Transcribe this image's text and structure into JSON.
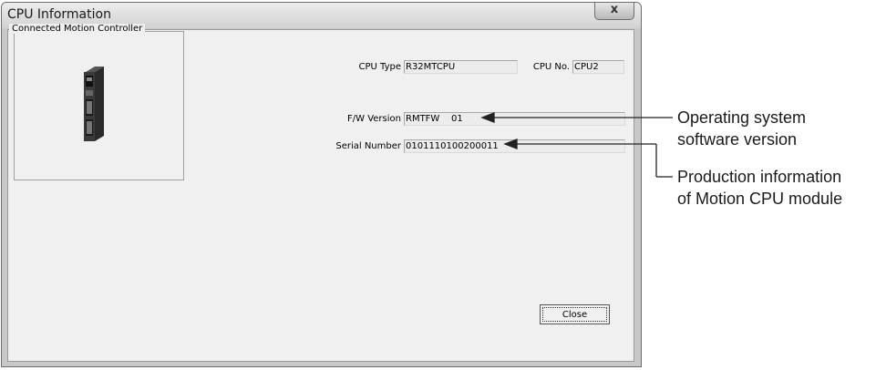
{
  "window": {
    "title": "CPU Information",
    "close_glyph": "x"
  },
  "group": {
    "legend": "Connected Motion Controller"
  },
  "fields": {
    "cpu_type_label": "CPU Type",
    "cpu_type_value": "R32MTCPU",
    "cpu_no_label": "CPU No.",
    "cpu_no_value": "CPU2",
    "fw_version_label": "F/W Version",
    "fw_version_value": "RMTFW    01",
    "serial_label": "Serial Number",
    "serial_value": "0101110100200011"
  },
  "buttons": {
    "close_label": "Close"
  },
  "callouts": {
    "fw_line1": "Operating system",
    "fw_line2": "software version",
    "serial_line1": "Production information",
    "serial_line2": "of Motion CPU module"
  }
}
